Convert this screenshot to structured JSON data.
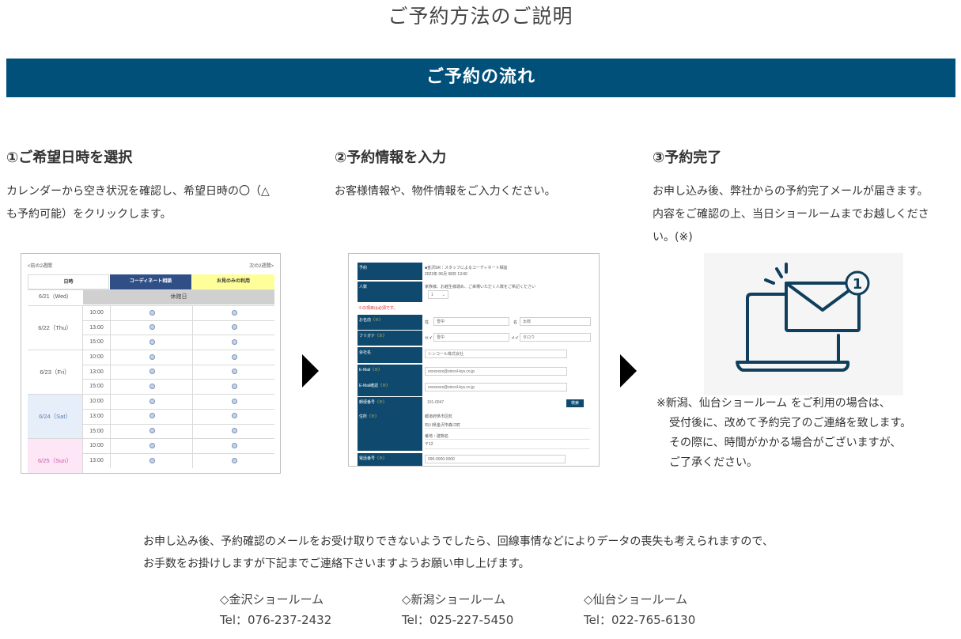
{
  "page_title": "ご予約方法のご説明",
  "banner_title": "ご予約の流れ",
  "steps": [
    {
      "title": "①ご希望日時を選択",
      "text": [
        "カレンダーから空き状況を確認し、希望日時の〇（△",
        "も予約可能）をクリックします。"
      ]
    },
    {
      "title": "②予約情報を入力",
      "text": [
        "お客様情報や、物件情報をご入力ください。"
      ]
    },
    {
      "title": "③予約完了",
      "text": [
        "お申し込み後、弊社からの予約完了メールが届きます。",
        "内容をご確認の上、当日ショールームまでお越しくださ",
        "い。(※)"
      ]
    }
  ],
  "calendar": {
    "prev_label": "<前の2週間",
    "next_label": "次の2週間>",
    "headers": [
      "日時",
      "コーディネート相談",
      "お見のみの利用"
    ],
    "closed_row": {
      "date": "6/21（Wed）",
      "label": "休館日"
    },
    "days": [
      {
        "date": "6/22（Thu）",
        "times": [
          "10:00",
          "13:00",
          "15:00"
        ]
      },
      {
        "date": "6/23（Fri）",
        "times": [
          "10:00",
          "13:00",
          "15:00"
        ]
      },
      {
        "date": "6/24（Sat）",
        "times": [
          "10:00",
          "13:00",
          "15:00"
        ]
      },
      {
        "date": "6/25（Sun）",
        "times": [
          "10:00",
          "13:00"
        ]
      }
    ]
  },
  "form": {
    "rows": [
      {
        "label": "予約",
        "value1": "■金沢SR｜スタッフによるコーディネート相談",
        "value2": "2023年 06月 08日 13:00"
      },
      {
        "label": "人数",
        "value1": "家族様、お越生様運め、ご来場いただく人数をご希記ください",
        "select": "1"
      },
      {
        "required_note": "※の項目は必須です。"
      },
      {
        "label": "お名前",
        "req": "（※）",
        "a_label": "姓",
        "a": "雪中",
        "b_label": "名",
        "b": "太郎"
      },
      {
        "label": "フリガナ",
        "req": "（※）",
        "a_label": "セイ",
        "a": "雪中",
        "b_label": "メイ",
        "b": "タロウ"
      },
      {
        "label": "会社名",
        "value": "シンコール株式会社"
      },
      {
        "label": "E-Mail",
        "req": "（※）",
        "value": "xxxxxxxx@sincol-kys.co.jp"
      },
      {
        "label": "E-Mail確認",
        "req": "（※）",
        "value": "xxxxxxxx@sincol-kys.co.jp"
      },
      {
        "label": "郵便番号",
        "req": "（※）",
        "value": "101-0047",
        "button": "検索"
      },
      {
        "label": "住所",
        "req": "（※）",
        "lines": [
          "都道府県市区町",
          "石川県金沢市森江町",
          "番地・建物名",
          "〒12"
        ]
      },
      {
        "label": "電話番号",
        "req": "（※）",
        "value": "090-0000-0000"
      }
    ]
  },
  "note_lines": [
    "※新潟、仙台ショールーム をご利用の場合は、",
    "受付後に、改めて予約完了のご連絡を致します。",
    "その際に、時間がかかる場合がございますが、",
    "ご了承ください。"
  ],
  "footer_lines": [
    "お申し込み後、予約確認のメールをお受け取りできないようでしたら、回線事情などによりデータの喪失も考えられますので、",
    "お手数をお掛けしますが下記までご連絡下さいますようお願い申し上げます。"
  ],
  "showrooms": [
    {
      "name": "◇金沢ショールーム",
      "tel": "Tel：076-237-2432"
    },
    {
      "name": "◇新潟ショールーム",
      "tel": "Tel：025-227-5450"
    },
    {
      "name": "◇仙台ショールーム",
      "tel": "Tel：022-765-6130"
    }
  ],
  "colors": {
    "banner": "#00507a",
    "icon_stroke": "#0f3f5c",
    "header_blue": "#2f4f86",
    "header_yellow": "#ffff99",
    "sat_bg": "#e6eef9",
    "sun_bg": "#fde6f6"
  }
}
